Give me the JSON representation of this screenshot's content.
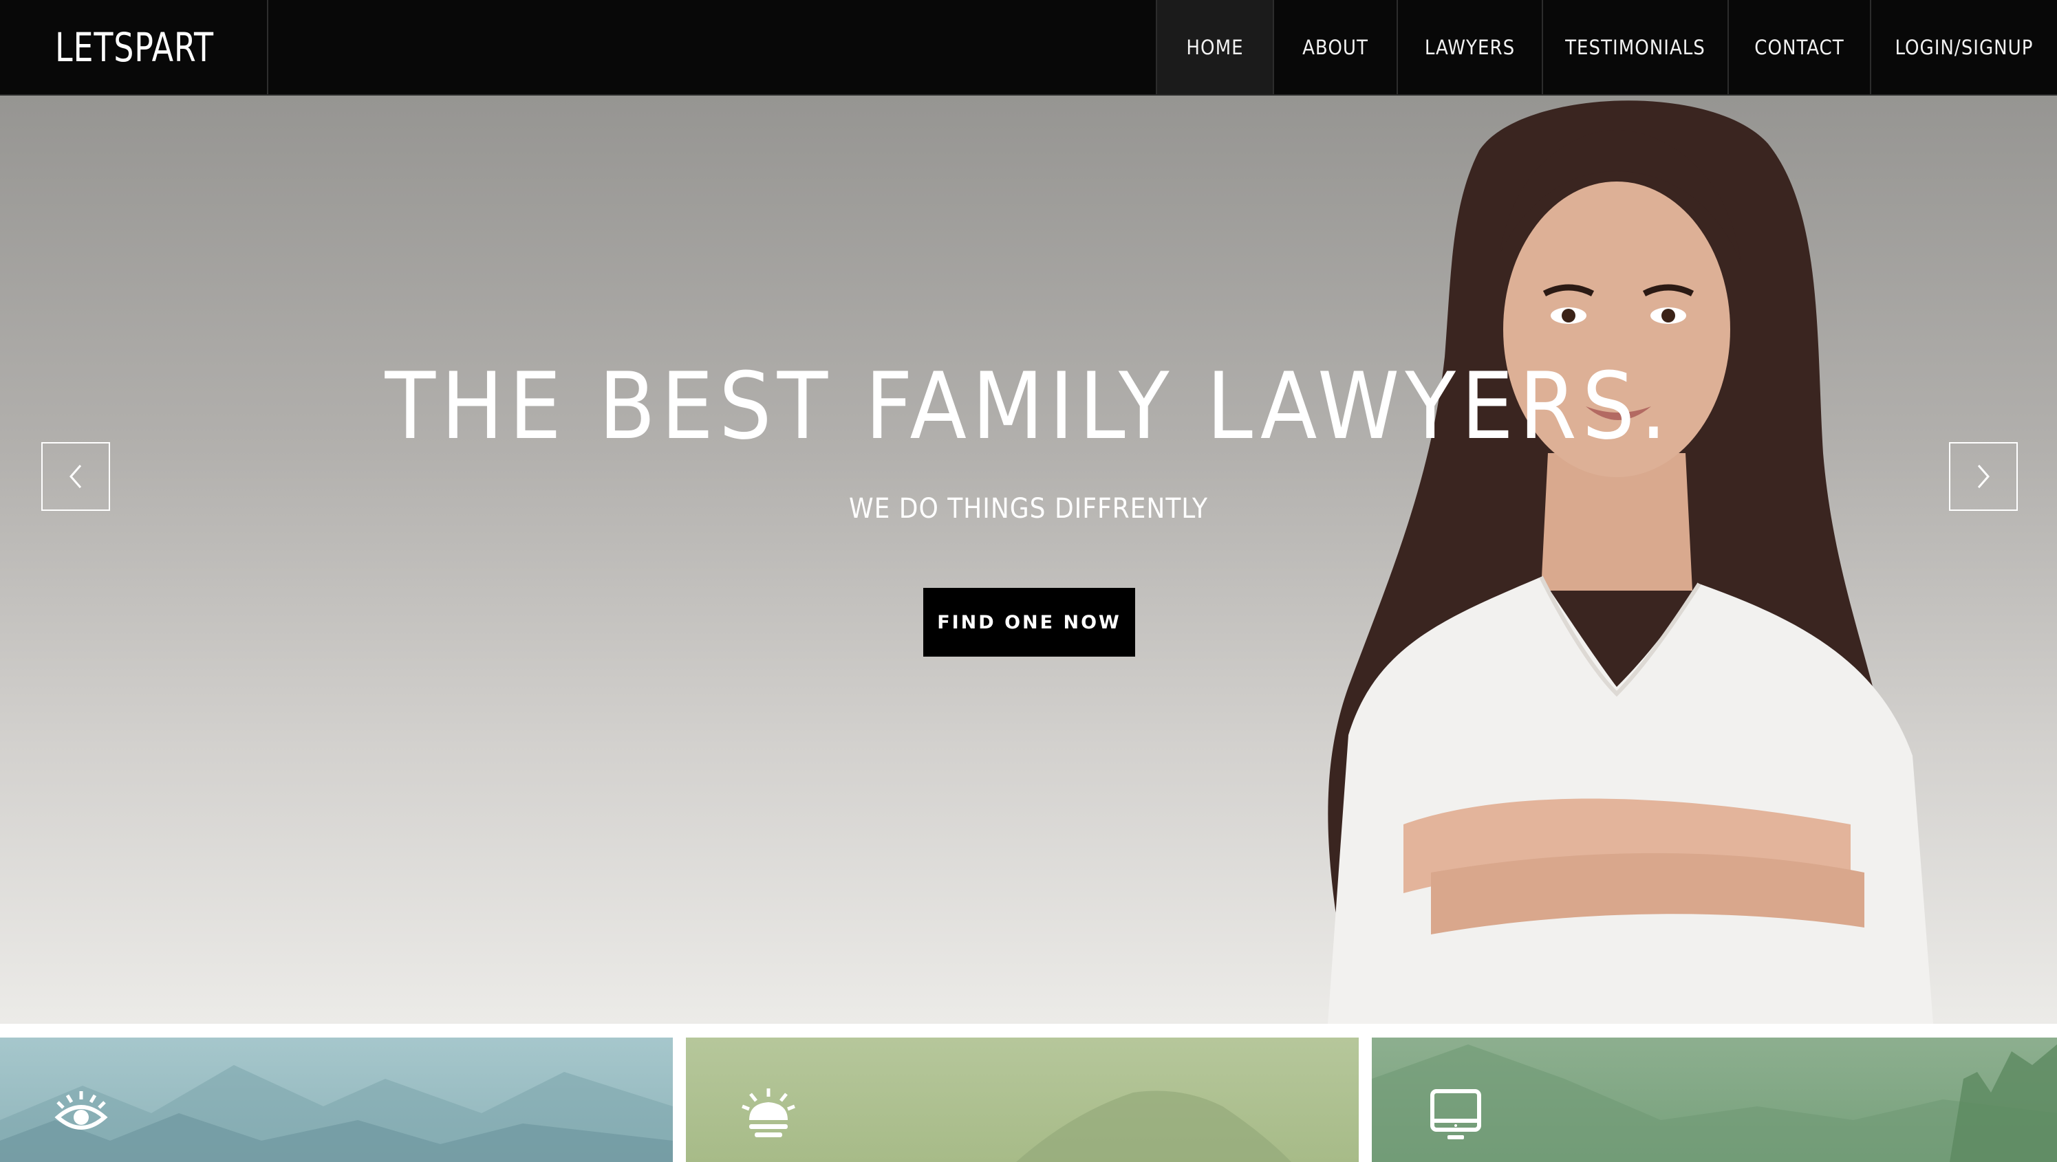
{
  "nav": {
    "brand": "LETSPART",
    "items": [
      {
        "label": "HOME",
        "active": true
      },
      {
        "label": "ABOUT"
      },
      {
        "label": "LAWYERS"
      },
      {
        "label": "TESTIMONIALS"
      },
      {
        "label": "CONTACT"
      },
      {
        "label": "LOGIN/SIGNUP"
      }
    ]
  },
  "hero": {
    "title": "THE BEST FAMILY LAWYERS.",
    "subtitle": "WE DO THINGS DIFFRENTLY",
    "cta": "FIND ONE NOW",
    "prev_icon": "chevron-left-icon",
    "next_icon": "chevron-right-icon"
  },
  "cards": [
    {
      "icon": "eye-icon",
      "color": "#9dbfc4"
    },
    {
      "icon": "lightbulb-icon",
      "color": "#b0c293"
    },
    {
      "icon": "monitor-icon",
      "color": "#83a886"
    }
  ],
  "colors": {
    "nav_bg": "#080808",
    "cta_bg": "#000000",
    "text_light": "#ffffff"
  }
}
